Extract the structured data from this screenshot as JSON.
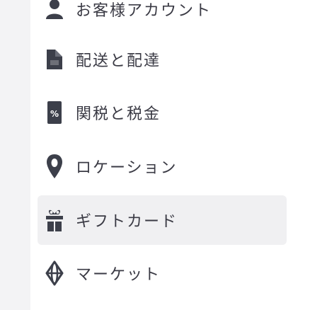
{
  "menu": {
    "items": [
      {
        "label": "お客様アカウント",
        "icon": "account-icon"
      },
      {
        "label": "配送と配達",
        "icon": "shipping-icon"
      },
      {
        "label": "関税と税金",
        "icon": "tax-icon"
      },
      {
        "label": "ロケーション",
        "icon": "location-pin-icon"
      },
      {
        "label": "ギフトカード",
        "icon": "gift-icon",
        "active": true
      },
      {
        "label": "マーケット",
        "icon": "globe-icon"
      }
    ]
  },
  "colors": {
    "icon": "#3c3f4a",
    "text": "#3a3a44",
    "active_bg": "#f0f0f2",
    "page_bg": "#f3f3f5"
  }
}
